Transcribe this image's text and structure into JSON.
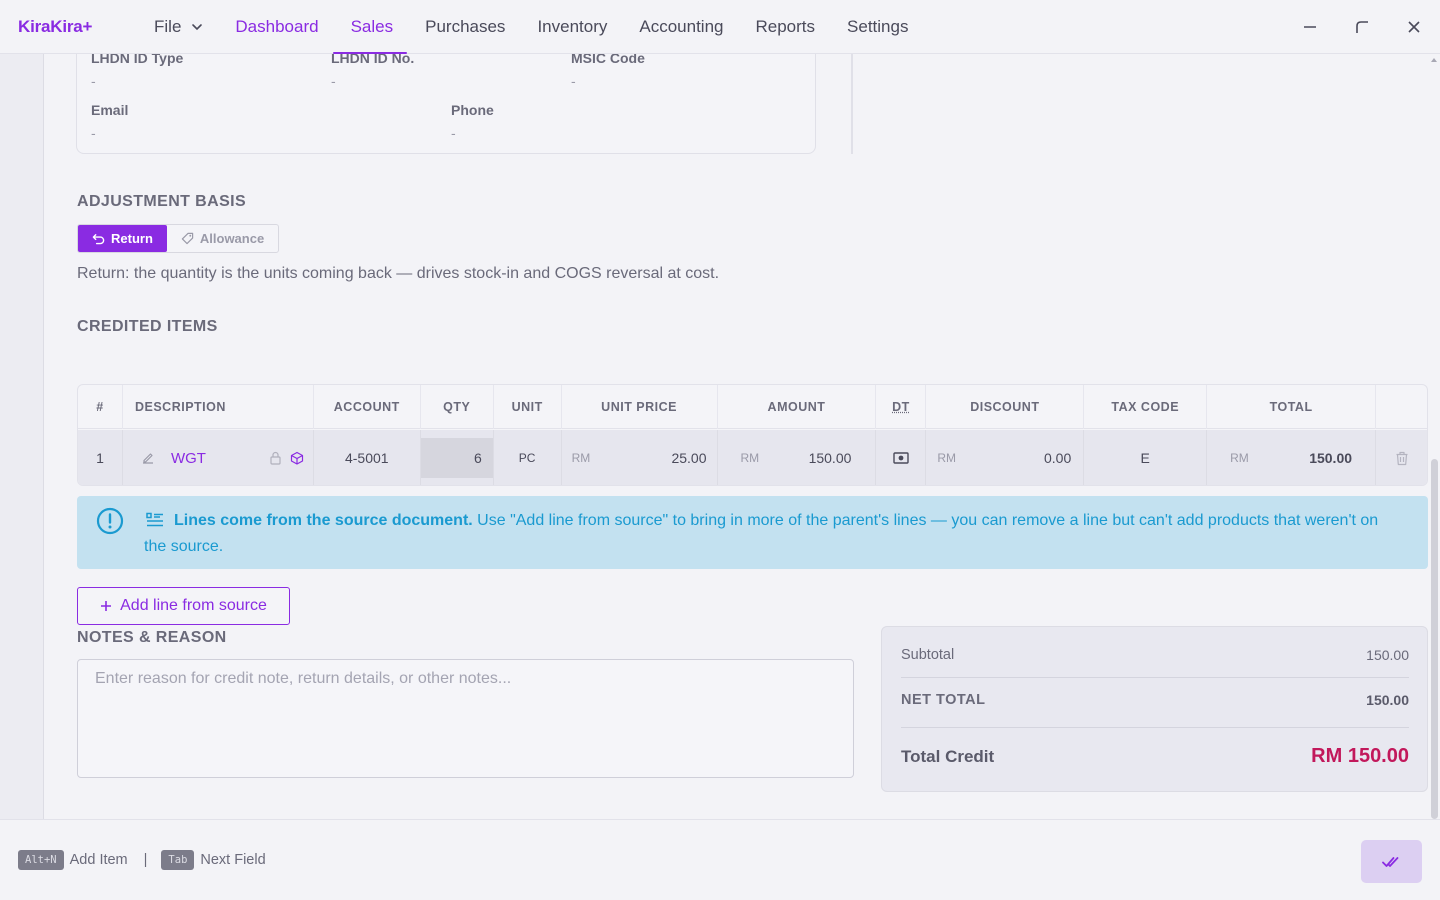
{
  "app": {
    "logo": "KiraKira+"
  },
  "nav": {
    "file": "File",
    "items": [
      "Dashboard",
      "Sales",
      "Purchases",
      "Inventory",
      "Accounting",
      "Reports",
      "Settings"
    ]
  },
  "customer": {
    "lhdn_id_type_label": "LHDN ID Type",
    "lhdn_id_type": "-",
    "lhdn_id_no_label": "LHDN ID No.",
    "lhdn_id_no": "-",
    "msic_label": "MSIC Code",
    "msic": "-",
    "email_label": "Email",
    "email": "-",
    "phone_label": "Phone",
    "phone": "-"
  },
  "adjustment": {
    "title": "ADJUSTMENT BASIS",
    "return_label": "Return",
    "allowance_label": "Allowance",
    "hint": "Return: the quantity is the units coming back — drives stock-in and COGS reversal at cost."
  },
  "items": {
    "title": "CREDITED ITEMS",
    "headers": [
      "#",
      "DESCRIPTION",
      "ACCOUNT",
      "QTY",
      "UNIT",
      "UNIT PRICE",
      "AMOUNT",
      "DT",
      "DISCOUNT",
      "TAX CODE",
      "TOTAL"
    ],
    "rows": [
      {
        "no": "1",
        "description": "WGT",
        "account": "4-5001",
        "qty": "6",
        "unit": "PC",
        "currency": "RM",
        "unit_price": "25.00",
        "amount": "150.00",
        "discount": "0.00",
        "tax_code": "E",
        "total": "150.00"
      }
    ]
  },
  "notice": {
    "bold": "Lines come from the source document.",
    "text": " Use \"Add line from source\" to bring in more of the parent's lines — you can remove a line but can't add products that weren't on the source."
  },
  "add_line_label": "Add line from source",
  "notes": {
    "title": "NOTES & REASON",
    "placeholder": "Enter reason for credit note, return details, or other notes..."
  },
  "totals": {
    "subtotal_label": "Subtotal",
    "subtotal": "150.00",
    "net_label": "NET TOTAL",
    "net": "150.00",
    "credit_label": "Total Credit",
    "credit": "RM 150.00"
  },
  "footer": {
    "key1": "Alt+N",
    "key1_label": "Add Item",
    "sep": "|",
    "key2": "Tab",
    "key2_label": "Next Field"
  },
  "colors": {
    "accent": "#8a2be2",
    "credit": "#c2185b",
    "info": "#1a9ad0"
  }
}
